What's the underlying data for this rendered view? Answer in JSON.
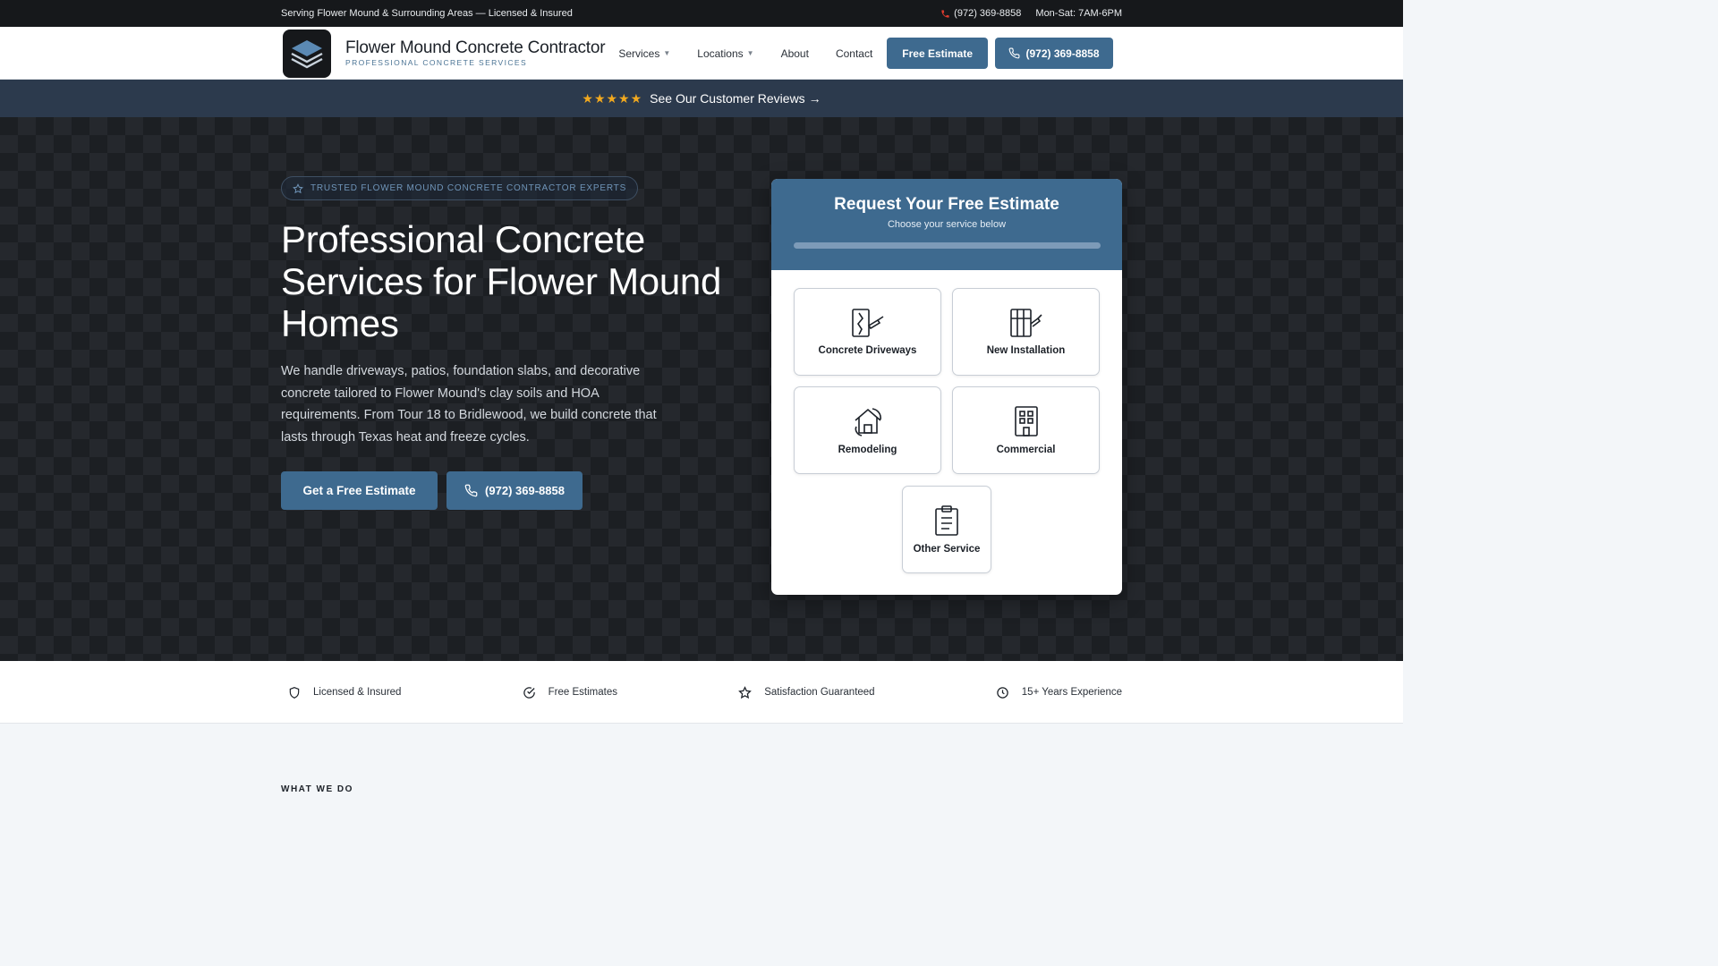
{
  "topbar": {
    "service_area": "Serving Flower Mound & Surrounding Areas — Licensed & Insured",
    "phone": "(972) 369-8858",
    "hours": "Mon-Sat: 7AM-6PM"
  },
  "header": {
    "brand_name": "Flower Mound Concrete Contractor",
    "brand_tagline": "PROFESSIONAL CONCRETE SERVICES",
    "nav": {
      "services": "Services",
      "locations": "Locations",
      "about": "About",
      "contact": "Contact"
    },
    "estimate_button": "Free Estimate",
    "phone_button": "(972) 369-8858"
  },
  "reviews_bar": {
    "stars": "★★★★★",
    "text": "See Our Customer Reviews →"
  },
  "hero": {
    "badge": "TRUSTED FLOWER MOUND CONCRETE CONTRACTOR EXPERTS",
    "title": "Professional Concrete Services for Flower Mound Homes",
    "description": "We handle driveways, patios, foundation slabs, and decorative concrete tailored to Flower Mound's clay soils and HOA requirements. From Tour 18 to Bridlewood, we build concrete that lasts through Texas heat and freeze cycles.",
    "cta_primary": "Get a Free Estimate",
    "cta_phone": "(972) 369-8858"
  },
  "estimate_form": {
    "title": "Request Your Free Estimate",
    "subtitle": "Choose your service below",
    "progress": 0,
    "services": [
      {
        "label": "Concrete Driveways",
        "icon": "driveway-icon"
      },
      {
        "label": "New Installation",
        "icon": "installation-icon"
      },
      {
        "label": "Remodeling",
        "icon": "home-remodel-icon"
      },
      {
        "label": "Commercial",
        "icon": "building-icon"
      },
      {
        "label": "Other Service",
        "icon": "clipboard-icon"
      }
    ]
  },
  "trust": [
    {
      "label": "Licensed & Insured",
      "icon": "shield-icon"
    },
    {
      "label": "Free Estimates",
      "icon": "check-circle-icon"
    },
    {
      "label": "Satisfaction Guaranteed",
      "icon": "star-icon"
    },
    {
      "label": "15+ Years Experience",
      "icon": "clock-icon"
    }
  ],
  "section": {
    "eyebrow": "WHAT WE DO"
  },
  "colors": {
    "accent": "#3e6a8f",
    "topbar_bg": "#16181b",
    "reviews_bg": "#2c3a4d",
    "star": "#f2a91f"
  }
}
